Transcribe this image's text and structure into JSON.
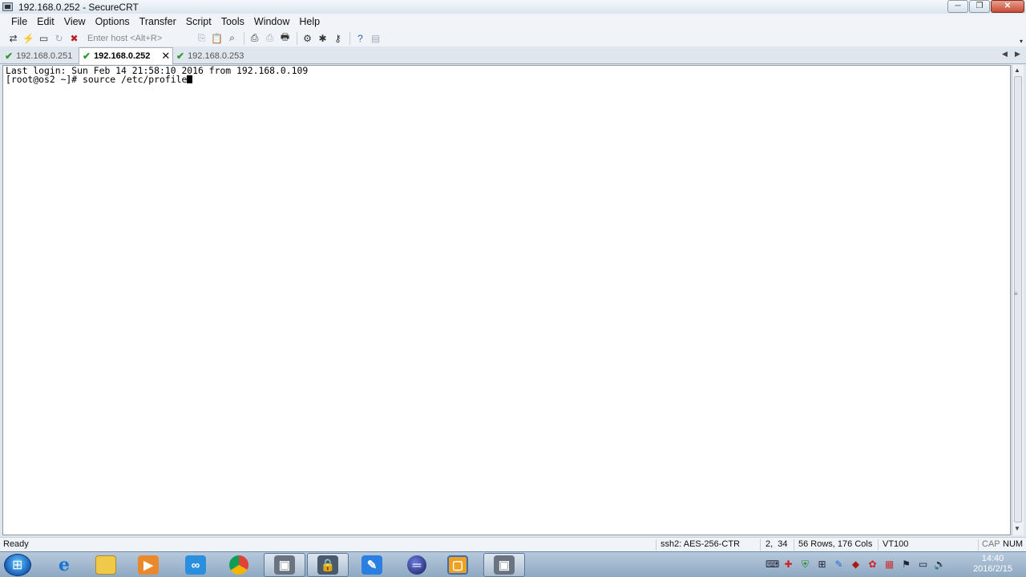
{
  "window": {
    "title": "192.168.0.252 - SecureCRT"
  },
  "menu": [
    "File",
    "Edit",
    "View",
    "Options",
    "Transfer",
    "Script",
    "Tools",
    "Window",
    "Help"
  ],
  "toolbar": {
    "host_placeholder": "Enter host <Alt+R>"
  },
  "tabs": [
    {
      "label": "192.168.0.251",
      "active": false
    },
    {
      "label": "192.168.0.252",
      "active": true
    },
    {
      "label": "192.168.0.253",
      "active": false
    }
  ],
  "terminal": {
    "lines": [
      "Last login: Sun Feb 14 21:58:10 2016 from 192.168.0.109",
      "[root@os2 ~]# source /etc/profile"
    ]
  },
  "status": {
    "ready": "Ready",
    "cipher": "ssh2: AES-256-CTR",
    "cursor_pos": "2,  34",
    "size": "56 Rows, 176 Cols",
    "emulation": "VT100",
    "cap": "CAP",
    "num": "NUM"
  },
  "taskbar": {
    "time": "14:40",
    "date": "2016/2/15"
  },
  "colors": {
    "tab_check": "#2e9a2e",
    "taskbar": "#9cb4cc"
  }
}
